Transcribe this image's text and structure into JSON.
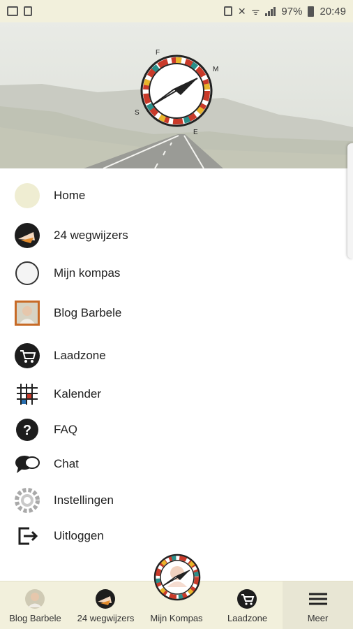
{
  "status_bar": {
    "battery": "97%",
    "time": "20:49"
  },
  "menu": {
    "items": [
      {
        "label": "Home",
        "icon": "home-icon"
      },
      {
        "label": "24 wegwijzers",
        "icon": "wegwijzers-icon"
      },
      {
        "label": "Mijn kompas",
        "icon": "compass-circle-icon"
      },
      {
        "label": "Blog Barbele",
        "icon": "blog-portrait-icon"
      },
      {
        "label": "Laadzone",
        "icon": "shopping-cart-icon"
      },
      {
        "label": "Kalender",
        "icon": "calendar-grid-icon"
      },
      {
        "label": "FAQ",
        "icon": "question-icon"
      },
      {
        "label": "Chat",
        "icon": "chat-bubbles-icon"
      },
      {
        "label": "Instellingen",
        "icon": "gear-icon"
      },
      {
        "label": "Uitloggen",
        "icon": "logout-icon"
      }
    ]
  },
  "bottom_nav": {
    "tabs": [
      {
        "label": "Blog Barbele"
      },
      {
        "label": "24 wegwijzers"
      },
      {
        "label": "Mijn Kompas"
      },
      {
        "label": "Laadzone"
      },
      {
        "label": "Meer"
      }
    ],
    "active": "Meer"
  },
  "colors": {
    "status_bar_bg": "#f2f0dc",
    "bottom_bar_bg": "#f2f0dc",
    "home_icon": "#efedd2",
    "text": "#222222"
  }
}
